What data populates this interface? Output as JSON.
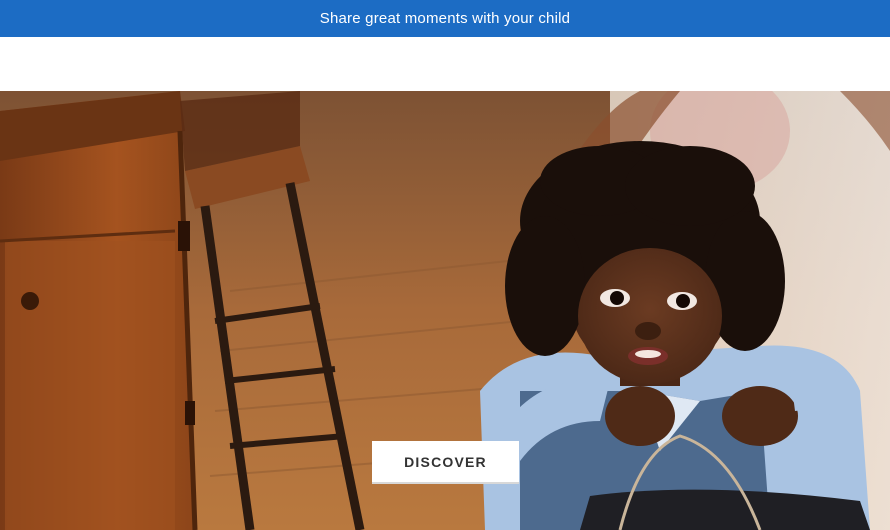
{
  "announcement": {
    "text": "Share great moments with your child"
  },
  "hero": {
    "image_subject": "child-holding-bag-in-wooden-room",
    "cta_label": "DISCOVER"
  },
  "colors": {
    "announcement_bg": "#1c6cc4",
    "announcement_text": "#ffffff",
    "button_bg": "#ffffff",
    "button_text": "#333333"
  }
}
